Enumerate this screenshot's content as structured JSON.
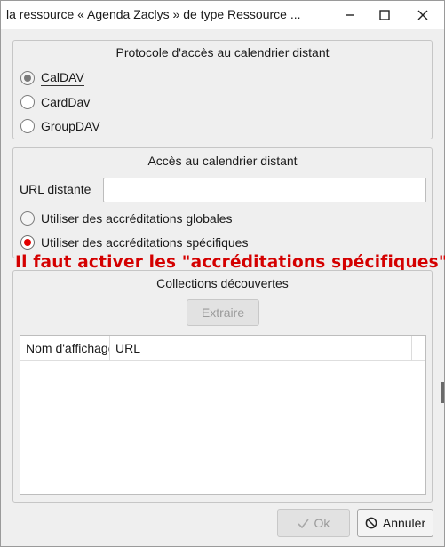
{
  "window": {
    "title": "la ressource « Agenda Zaclys » de type Ressource ...",
    "minimize_icon": "minimize-icon",
    "maximize_icon": "maximize-icon",
    "close_icon": "close-icon"
  },
  "protocol_group": {
    "title": "Protocole d'accès au calendrier distant",
    "options": [
      {
        "label": "CalDAV",
        "checked": true
      },
      {
        "label": "CardDav",
        "checked": false
      },
      {
        "label": "GroupDAV",
        "checked": false
      }
    ]
  },
  "access_group": {
    "title": "Accès au calendrier distant",
    "url_label": "URL distante",
    "url_value": "",
    "options": [
      {
        "label": "Utiliser des accréditations globales",
        "checked": false
      },
      {
        "label": "Utiliser des accréditations spécifiques",
        "checked": true
      }
    ]
  },
  "annotation": {
    "text": "Il faut activer les \"accréditations spécifiques\"",
    "color": "#d40000"
  },
  "collections_group": {
    "title": "Collections découvertes",
    "extract_button": "Extraire",
    "columns": [
      "Nom d'affichage",
      "URL"
    ],
    "rows": []
  },
  "footer": {
    "ok_label": "Ok",
    "ok_icon": "check-icon",
    "cancel_label": "Annuler",
    "cancel_icon": "cancel-icon"
  },
  "colors": {
    "selected_radio_red": "#e30000",
    "selected_radio_grey": "#7a7a7a",
    "annotation_red": "#d40000"
  }
}
